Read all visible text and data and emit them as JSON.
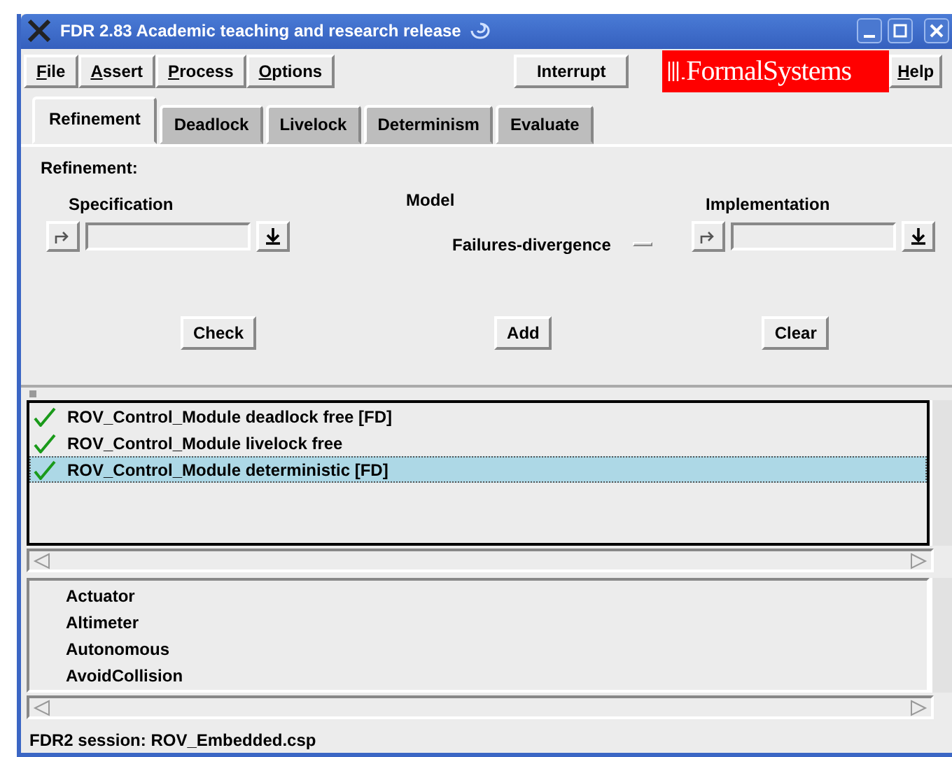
{
  "window": {
    "title": "FDR 2.83 Academic teaching and research release"
  },
  "menu": [
    {
      "label": "File"
    },
    {
      "label": "Assert"
    },
    {
      "label": "Process"
    },
    {
      "label": "Options"
    }
  ],
  "interrupt_button": "Interrupt",
  "logo": "FormalSystems",
  "help_menu": "Help",
  "tabs": [
    {
      "label": "Refinement",
      "selected": true
    },
    {
      "label": "Deadlock",
      "selected": false
    },
    {
      "label": "Livelock",
      "selected": false
    },
    {
      "label": "Determinism",
      "selected": false
    },
    {
      "label": "Evaluate",
      "selected": false
    }
  ],
  "refinement": {
    "heading": "Refinement:",
    "specification_label": "Specification",
    "model_label": "Model",
    "model_value": "Failures-divergence",
    "implementation_label": "Implementation",
    "buttons": [
      "Check",
      "Add",
      "Clear"
    ]
  },
  "assertions": [
    {
      "text": "ROV_Control_Module deadlock free [FD]",
      "passed": true,
      "selected": false
    },
    {
      "text": "ROV_Control_Module livelock free",
      "passed": true,
      "selected": false
    },
    {
      "text": "ROV_Control_Module deterministic [FD]",
      "passed": true,
      "selected": true
    }
  ],
  "processes": [
    "Actuator",
    "Altimeter",
    "Autonomous",
    "AvoidCollision"
  ],
  "status_bar": "FDR2 session: ROV_Embedded.csp"
}
